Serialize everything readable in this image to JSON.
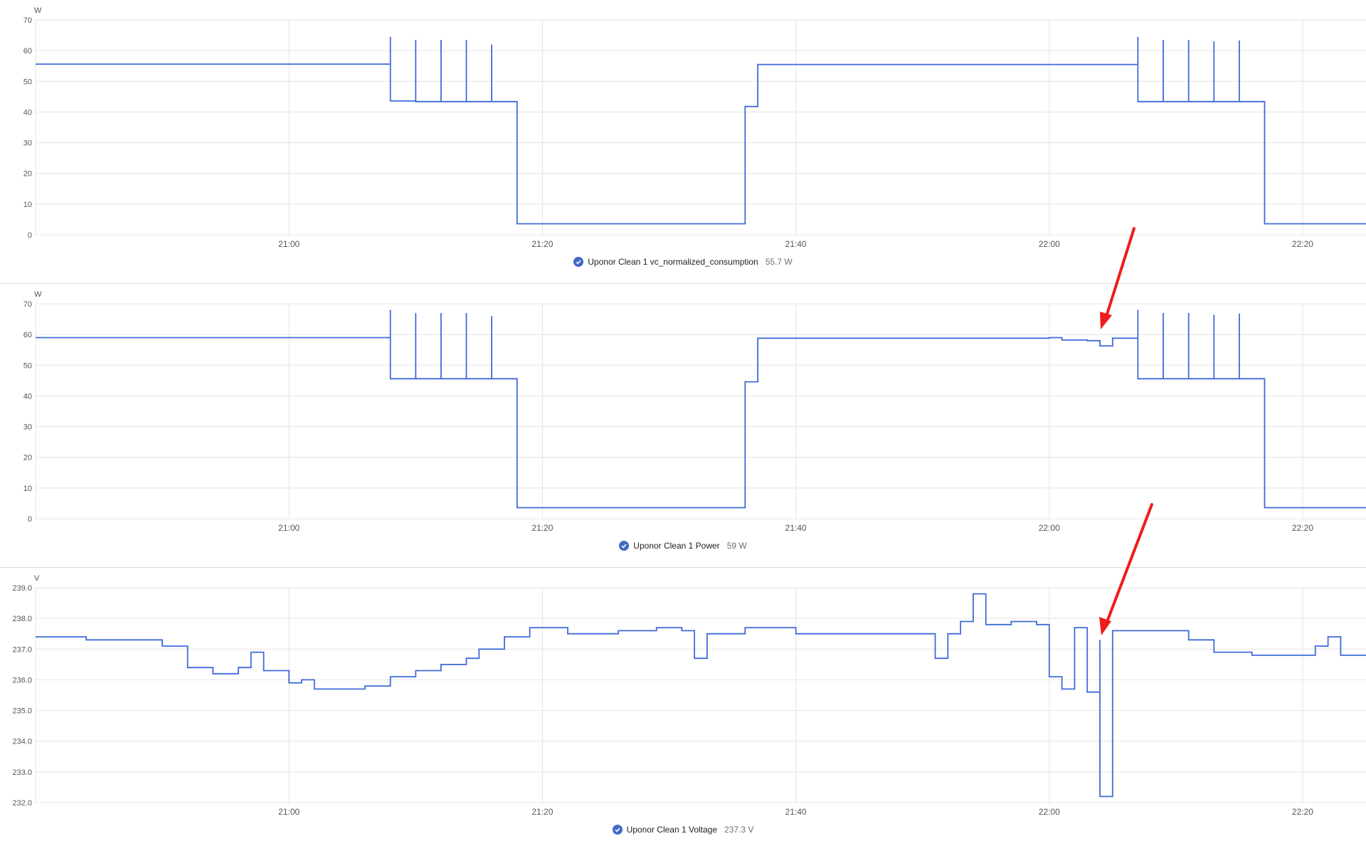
{
  "colors": {
    "series": "#3f6ad8",
    "grid": "#e4e4e4",
    "axis_text": "#555555",
    "annotation_arrow": "#ee1c1c",
    "legend_check": "#4169c8"
  },
  "x_ticks": [
    "21:00",
    "21:20",
    "21:40",
    "22:00",
    "22:20"
  ],
  "chart_data": [
    {
      "type": "line",
      "unit": "W",
      "ylim": [
        0,
        70
      ],
      "yticks": [
        "0",
        "10",
        "20",
        "30",
        "40",
        "50",
        "60",
        "70"
      ],
      "xlim": [
        "20:40",
        "22:25"
      ],
      "grid": true,
      "legend_position": "bottom-center",
      "series": [
        {
          "name": "Uponor Clean 1 vc_normalized_consumption",
          "current_value": "55.7 W",
          "points": [
            [
              "20:40",
              55.6
            ],
            [
              "21:08",
              55.6
            ],
            [
              "21:08",
              64.5
            ],
            [
              "21:08",
              43.6
            ],
            [
              "21:10",
              43.4
            ],
            [
              "21:10",
              63.5
            ],
            [
              "21:10",
              43.4
            ],
            [
              "21:12",
              43.4
            ],
            [
              "21:12",
              63.5
            ],
            [
              "21:12",
              43.4
            ],
            [
              "21:14",
              43.4
            ],
            [
              "21:14",
              63.5
            ],
            [
              "21:14",
              43.4
            ],
            [
              "21:16",
              43.4
            ],
            [
              "21:16",
              62.0
            ],
            [
              "21:16",
              43.4
            ],
            [
              "21:18",
              43.4
            ],
            [
              "21:18",
              3.6
            ],
            [
              "21:36",
              3.6
            ],
            [
              "21:36",
              41.8
            ],
            [
              "21:37",
              41.8
            ],
            [
              "21:37",
              55.5
            ],
            [
              "22:07",
              55.6
            ],
            [
              "22:07",
              64.5
            ],
            [
              "22:07",
              43.4
            ],
            [
              "22:09",
              43.4
            ],
            [
              "22:09",
              63.5
            ],
            [
              "22:09",
              43.4
            ],
            [
              "22:11",
              43.4
            ],
            [
              "22:11",
              63.5
            ],
            [
              "22:11",
              43.4
            ],
            [
              "22:13",
              43.4
            ],
            [
              "22:13",
              63.0
            ],
            [
              "22:13",
              43.4
            ],
            [
              "22:15",
              43.4
            ],
            [
              "22:15",
              63.3
            ],
            [
              "22:15",
              43.4
            ],
            [
              "22:17",
              43.4
            ],
            [
              "22:17",
              3.6
            ],
            [
              "22:25",
              3.6
            ]
          ]
        }
      ]
    },
    {
      "type": "line",
      "unit": "W",
      "ylim": [
        0,
        70
      ],
      "yticks": [
        "0",
        "10",
        "20",
        "30",
        "40",
        "50",
        "60",
        "70"
      ],
      "xlim": [
        "20:40",
        "22:25"
      ],
      "grid": true,
      "legend_position": "bottom-center",
      "series": [
        {
          "name": "Uponor Clean 1 Power",
          "current_value": "59 W",
          "points": [
            [
              "20:40",
              59.0
            ],
            [
              "21:08",
              58.5
            ],
            [
              "21:08",
              68.0
            ],
            [
              "21:08",
              45.6
            ],
            [
              "21:10",
              45.6
            ],
            [
              "21:10",
              67.0
            ],
            [
              "21:10",
              45.6
            ],
            [
              "21:12",
              45.6
            ],
            [
              "21:12",
              67.0
            ],
            [
              "21:12",
              45.6
            ],
            [
              "21:14",
              45.6
            ],
            [
              "21:14",
              67.0
            ],
            [
              "21:14",
              45.6
            ],
            [
              "21:16",
              45.6
            ],
            [
              "21:16",
              66.0
            ],
            [
              "21:16",
              45.6
            ],
            [
              "21:18",
              45.6
            ],
            [
              "21:18",
              3.6
            ],
            [
              "21:36",
              3.6
            ],
            [
              "21:36",
              44.6
            ],
            [
              "21:37",
              44.6
            ],
            [
              "21:37",
              58.8
            ],
            [
              "22:00",
              59.0
            ],
            [
              "22:01",
              58.2
            ],
            [
              "22:03",
              58.0
            ],
            [
              "22:04",
              56.3
            ],
            [
              "22:05",
              58.8
            ],
            [
              "22:07",
              59.0
            ],
            [
              "22:07",
              68.0
            ],
            [
              "22:07",
              45.6
            ],
            [
              "22:09",
              45.6
            ],
            [
              "22:09",
              67.0
            ],
            [
              "22:09",
              45.6
            ],
            [
              "22:11",
              45.6
            ],
            [
              "22:11",
              67.0
            ],
            [
              "22:11",
              45.6
            ],
            [
              "22:13",
              45.6
            ],
            [
              "22:13",
              66.5
            ],
            [
              "22:13",
              45.6
            ],
            [
              "22:15",
              45.6
            ],
            [
              "22:15",
              66.8
            ],
            [
              "22:15",
              45.6
            ],
            [
              "22:17",
              45.6
            ],
            [
              "22:17",
              3.6
            ],
            [
              "22:25",
              3.6
            ]
          ]
        }
      ]
    },
    {
      "type": "line",
      "unit": "V",
      "ylim": [
        232.0,
        239.0
      ],
      "yticks": [
        "232.0",
        "233.0",
        "234.0",
        "235.0",
        "236.0",
        "237.0",
        "238.0",
        "239.0"
      ],
      "xlim": [
        "20:40",
        "22:25"
      ],
      "grid": true,
      "legend_position": "bottom-center",
      "series": [
        {
          "name": "Uponor Clean 1 Voltage",
          "current_value": "237.3 V",
          "points": [
            [
              "20:40",
              237.4
            ],
            [
              "20:44",
              237.3
            ],
            [
              "20:48",
              237.3
            ],
            [
              "20:50",
              237.1
            ],
            [
              "20:52",
              236.4
            ],
            [
              "20:54",
              236.2
            ],
            [
              "20:56",
              236.4
            ],
            [
              "20:57",
              236.9
            ],
            [
              "20:58",
              236.3
            ],
            [
              "21:00",
              235.9
            ],
            [
              "21:01",
              236.0
            ],
            [
              "21:02",
              235.7
            ],
            [
              "21:04",
              235.7
            ],
            [
              "21:06",
              235.8
            ],
            [
              "21:08",
              236.1
            ],
            [
              "21:10",
              236.3
            ],
            [
              "21:12",
              236.5
            ],
            [
              "21:14",
              236.7
            ],
            [
              "21:15",
              237.0
            ],
            [
              "21:17",
              237.4
            ],
            [
              "21:19",
              237.7
            ],
            [
              "21:22",
              237.5
            ],
            [
              "21:26",
              237.6
            ],
            [
              "21:29",
              237.7
            ],
            [
              "21:31",
              237.6
            ],
            [
              "21:32",
              236.7
            ],
            [
              "21:33",
              237.5
            ],
            [
              "21:36",
              237.7
            ],
            [
              "21:40",
              237.5
            ],
            [
              "21:44",
              237.5
            ],
            [
              "21:48",
              237.5
            ],
            [
              "21:51",
              236.7
            ],
            [
              "21:52",
              237.5
            ],
            [
              "21:53",
              237.9
            ],
            [
              "21:54",
              238.8
            ],
            [
              "21:55",
              237.8
            ],
            [
              "21:57",
              237.9
            ],
            [
              "21:59",
              237.8
            ],
            [
              "22:00",
              236.1
            ],
            [
              "22:01",
              235.7
            ],
            [
              "22:02",
              236.0
            ],
            [
              "22:02",
              237.7
            ],
            [
              "22:03",
              235.6
            ],
            [
              "22:04",
              235.5
            ],
            [
              "22:04",
              237.3
            ],
            [
              "22:04",
              232.2
            ],
            [
              "22:05",
              232.2
            ],
            [
              "22:05",
              237.6
            ],
            [
              "22:08",
              237.6
            ],
            [
              "22:11",
              237.3
            ],
            [
              "22:13",
              236.9
            ],
            [
              "22:16",
              236.8
            ],
            [
              "22:19",
              236.8
            ],
            [
              "22:21",
              237.1
            ],
            [
              "22:22",
              237.4
            ],
            [
              "22:23",
              236.8
            ],
            [
              "22:25",
              236.8
            ]
          ]
        }
      ]
    }
  ]
}
